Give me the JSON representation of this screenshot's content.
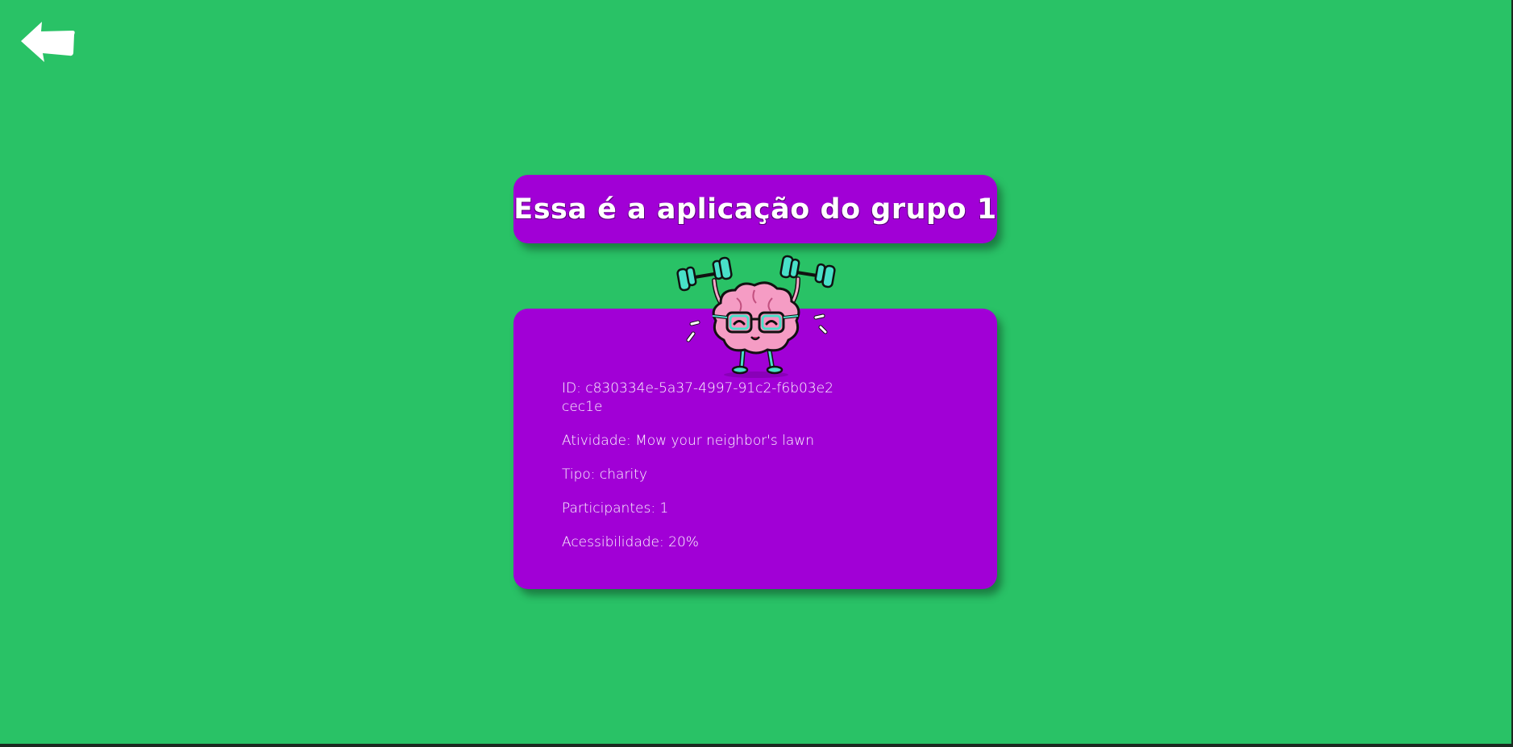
{
  "nav": {
    "back_icon": "back-arrow-icon"
  },
  "header": {
    "title": "Essa é a aplicação do grupo 1"
  },
  "mascot": {
    "icon": "brain-lifting-dumbbells-icon"
  },
  "activity": {
    "id_label": "ID",
    "id_value": "c830334e-5a37-4997-91c2-f6b03e2cec1e",
    "activity_label": "Atividade",
    "activity_value": "Mow your neighbor's lawn",
    "type_label": "Tipo",
    "type_value": "charity",
    "participants_label": "Participantes",
    "participants_value": "1",
    "accessibility_label": "Acessibilidade",
    "accessibility_value": "20%"
  },
  "colors": {
    "background": "#29c266",
    "card": "#a100d6",
    "text": "#ffffff"
  }
}
